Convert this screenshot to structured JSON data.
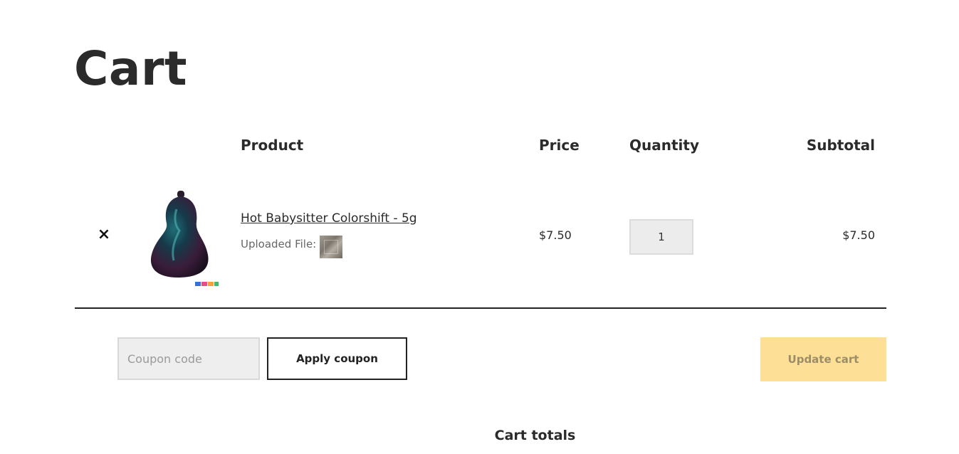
{
  "page": {
    "title": "Cart"
  },
  "table": {
    "headers": {
      "product": "Product",
      "price": "Price",
      "quantity": "Quantity",
      "subtotal": "Subtotal"
    },
    "rows": [
      {
        "remove_glyph": "×",
        "product_name": "Hot Babysitter Colorshift - 5g",
        "uploaded_label": "Uploaded File:",
        "price": "$7.50",
        "quantity": "1",
        "subtotal": "$7.50",
        "thumbnail_icon": "paint-bottle-image"
      }
    ]
  },
  "coupon": {
    "placeholder": "Coupon code",
    "apply_label": "Apply coupon"
  },
  "actions": {
    "update_label": "Update cart"
  },
  "totals": {
    "heading": "Cart totals"
  },
  "colors": {
    "update_button": "#fde096",
    "input_bg": "#ececec",
    "text": "#2b2b2b"
  }
}
